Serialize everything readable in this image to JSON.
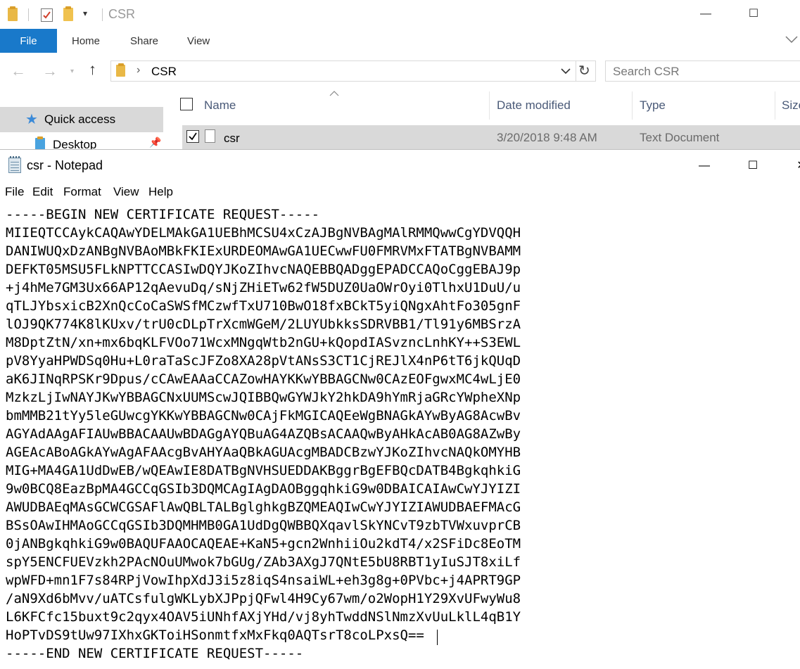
{
  "explorer": {
    "title": "CSR",
    "ribbon_tabs": {
      "file": "File",
      "home": "Home",
      "share": "Share",
      "view": "View"
    },
    "address_path": "CSR",
    "search_placeholder": "Search CSR",
    "nav_items": {
      "quick_access": "Quick access",
      "desktop": "Desktop"
    },
    "columns": {
      "name": "Name",
      "date_modified": "Date modified",
      "type": "Type",
      "size": "Size"
    },
    "file_row": {
      "name": "csr",
      "date_modified": "3/20/2018 9:48 AM",
      "type": "Text Document"
    }
  },
  "notepad": {
    "title": "csr - Notepad",
    "menu": {
      "file": "File",
      "edit": "Edit",
      "format": "Format",
      "view": "View",
      "help": "Help"
    },
    "content": "-----BEGIN NEW CERTIFICATE REQUEST-----\nMIIEQTCCAykCAQAwYDELMAkGA1UEBhMCSU4xCzAJBgNVBAgMAlRMMQwwCgYDVQQH\nDANIWUQxDzANBgNVBAoMBkFKIExURDEOMAwGA1UECwwFU0FMRVMxFTATBgNVBAMM\nDEFKT05MSU5FLkNPTTCCASIwDQYJKoZIhvcNAQEBBQADggEPADCCAQoCggEBAJ9p\n+j4hMe7GM3Ux66AP12qAevuDq/sNjZHiETw62fW5DUZ0UaOWrOyi0TlhxU1DuU/u\nqTLJYbsxicB2XnQcCoCaSWSfMCzwfTxU710BwO18fxBCkT5yiQNgxAhtFo305gnF\nlOJ9QK774K8lKUxv/trU0cDLpTrXcmWGeM/2LUYUbkksSDRVBB1/Tl91y6MBSrzA\nM8DptZtN/xn+mx6bqKLFVOo71WcxMNgqWtb2nGU+kQopdIASvzncLnhKY++S3EWL\npV8YyaHPWDSq0Hu+L0raTaScJFZo8XA28pVtANsS3CT1CjREJlX4nP6tT6jkQUqD\naK6JINqRPSKr9Dpus/cCAwEAAaCCAZowHAYKKwYBBAGCNw0CAzEOFgwxMC4wLjE0\nMzkzLjIwNAYJKwYBBAGCNxUUMScwJQIBBQwGYWJkY2hkDA9hYmRjaGRcYWpheXNp\nbmMMB21tYy5leGUwcgYKKwYBBAGCNw0CAjFkMGICAQEeWgBNAGkAYwByAG8AcwBv\nAGYAdAAgAFIAUwBBACAAUwBDAGgAYQBuAG4AZQBsACAAQwByAHkAcAB0AG8AZwBy\nAGEAcABoAGkAYwAgAFAAcgBvAHYAaQBkAGUAcgMBADCBzwYJKoZIhvcNAQkOMYHB\nMIG+MA4GA1UdDwEB/wQEAwIE8DATBgNVHSUEDDAKBggrBgEFBQcDATB4BgkqhkiG\n9w0BCQ8EazBpMA4GCCqGSIb3DQMCAgIAgDAOBggqhkiG9w0DBAICAIAwCwYJYIZI\nAWUDBAEqMAsGCWCGSAFlAwQBLTALBglghkgBZQMEAQIwCwYJYIZIAWUDBAEFMAcG\nBSsOAwIHMAoGCCqGSIb3DQMHMB0GA1UdDgQWBBQXqavlSkYNCvT9zbTVWxuvprCB\n0jANBgkqhkiG9w0BAQUFAAOCAQEAE+KaN5+gcn2WnhiiOu2kdT4/x2SFiDc8EoTM\nspY5ENCFUEVzkh2PAcNOuUMwok7bGUg/ZAb3AXgJ7QNtE5bU8RBT1yIuSJT8xiLf\nwpWFD+mn1F7s84RPjVowIhpXdJ3i5z8iqS4nsaiWL+eh3g8g+0PVbc+j4APRT9GP\n/aN9Xd6bMvv/uATCsfulgWKLybXJPpjQFwl4H9Cy67wm/o2WopH1Y29XvUFwyWu8\nL6KFCfc15buxt9c2qyx4OAV5iUNhfAXjYHd/vj8yhTwddNSlNmzXvUuLklL4qB1Y\nHoPTvDS9tUw97IXhxGKToiHSonmtfxMxFkq0AQTsrT8coLPxsQ==\n-----END NEW CERTIFICATE REQUEST-----"
  }
}
